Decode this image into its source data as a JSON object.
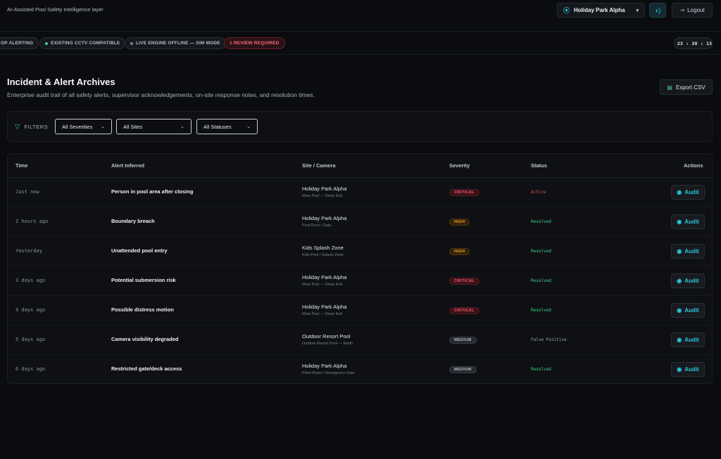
{
  "header": {
    "tagline": "AI-Assisted Pool Safety Intelligence layer",
    "site_selector": {
      "value": "Holiday Park Alpha",
      "icon": "map-pin-icon"
    },
    "sound_icon": "speaker-icon",
    "logout_label": "Logout"
  },
  "status_strip": {
    "pills": [
      {
        "label": "OP ALERTING"
      },
      {
        "label": "EXISTING CCTV COMPATIBLE",
        "dot_color": "#3fd18a"
      },
      {
        "label": "LIVE ENGINE OFFLINE — SIM MODE",
        "dot_color": "#7b828c"
      },
      {
        "label": "1 REVIEW REQUIRED"
      }
    ],
    "clock": "23 : 38 : 13",
    "clock_dot_color": "#2cc4d8"
  },
  "page": {
    "title": "Incident & Alert Archives",
    "subtitle": "Enterprise audit trail of all safety alerts, supervisor acknowledgements, on-site response notes, and resolution times.",
    "export_label": "Export CSV"
  },
  "filters": {
    "label": "FILTERS",
    "severity": "All Severities",
    "site": "All Sites",
    "status": "All Statuses"
  },
  "table": {
    "columns": [
      "Time",
      "Alert Inferred",
      "Site / Camera",
      "Severity",
      "Status",
      "Actions"
    ],
    "action_label": "Audit",
    "rows": [
      {
        "time": "Just now",
        "alert": "Person in pool area after closing",
        "site": "Holiday Park Alpha",
        "camera": "Main Pool — Deep End",
        "severity": "CRITICAL",
        "status": "Active"
      },
      {
        "time": "2 hours ago",
        "alert": "Boundary breach",
        "site": "Holiday Park Alpha",
        "camera": "Pool Deck / Gate",
        "severity": "HIGH",
        "status": "Resolved"
      },
      {
        "time": "Yesterday",
        "alert": "Unattended pool entry",
        "site": "Kids Splash Zone",
        "camera": "Kids Pool / Splash Zone",
        "severity": "HIGH",
        "status": "Resolved"
      },
      {
        "time": "3 days ago",
        "alert": "Potential submersion risk",
        "site": "Holiday Park Alpha",
        "camera": "Main Pool — Deep End",
        "severity": "CRITICAL",
        "status": "Resolved"
      },
      {
        "time": "4 days ago",
        "alert": "Possible distress motion",
        "site": "Holiday Park Alpha",
        "camera": "Main Pool — Deep End",
        "severity": "CRITICAL",
        "status": "Resolved"
      },
      {
        "time": "5 days ago",
        "alert": "Camera visibility degraded",
        "site": "Outdoor Resort Pool",
        "camera": "Outdoor Resort Pool — North",
        "severity": "MEDIUM",
        "status": "False Positive"
      },
      {
        "time": "6 days ago",
        "alert": "Restricted gate/deck access",
        "site": "Holiday Park Alpha",
        "camera": "Plant Room / Emergency Gate",
        "severity": "MEDIUM",
        "status": "Resolved"
      }
    ]
  }
}
